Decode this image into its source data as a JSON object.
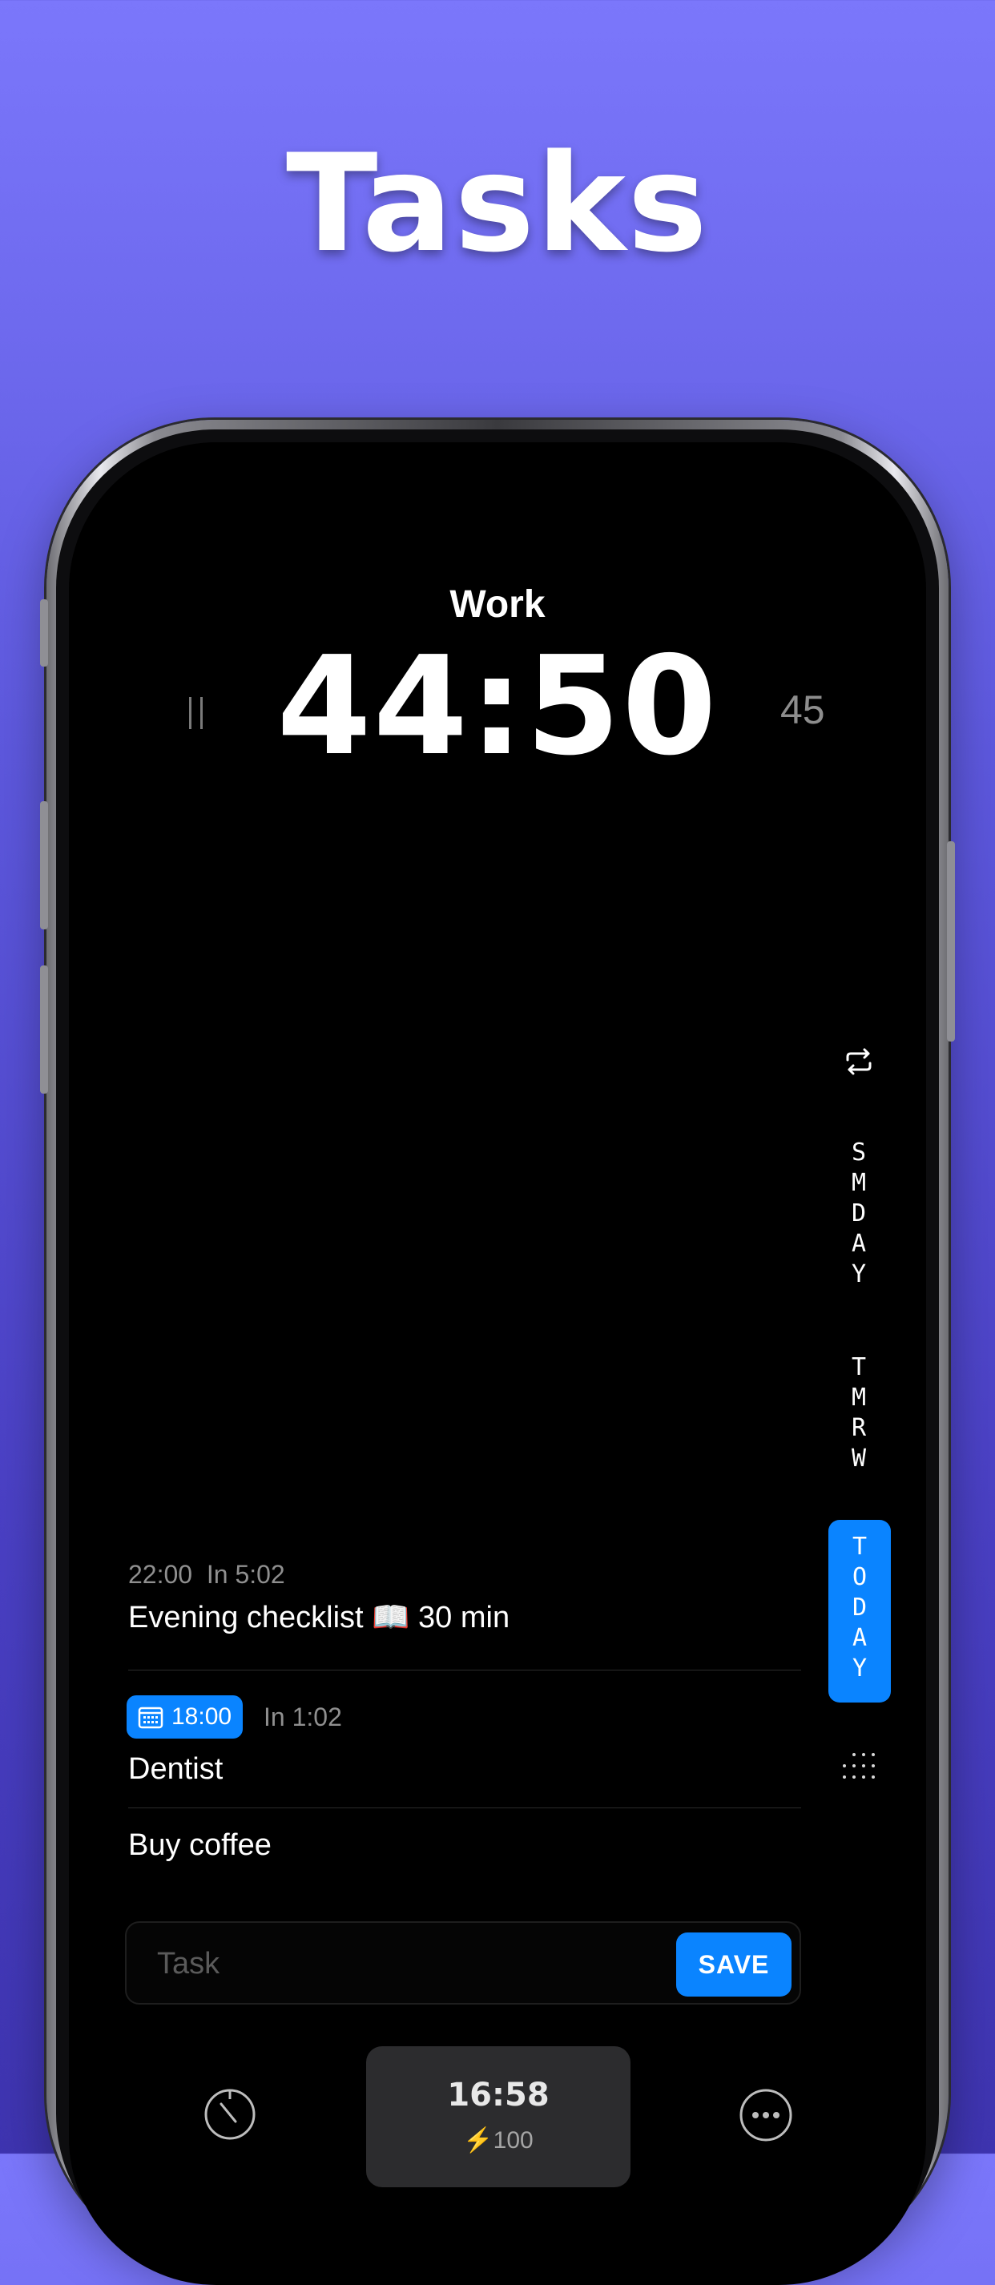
{
  "headline": "Tasks",
  "timer": {
    "mode": "Work",
    "time": "44:50",
    "duration": "45",
    "pause_icon": "pause-icon"
  },
  "day_selector": {
    "repeat_icon": "repeat-icon",
    "items": [
      {
        "label": "SMDAY",
        "letters": [
          "S",
          "M",
          "D",
          "A",
          "Y"
        ]
      },
      {
        "label": "TMRW",
        "letters": [
          "T",
          "M",
          "R",
          "W"
        ]
      },
      {
        "label": "TODAY",
        "letters": [
          "T",
          "O",
          "D",
          "A",
          "Y"
        ],
        "selected": true
      }
    ],
    "grid_icon": "dot-grid-icon"
  },
  "tasks": [
    {
      "time": "22:00",
      "relative": "In 5:02",
      "title": "Evening checklist 📖 30 min"
    },
    {
      "badge_time": "18:00",
      "relative": "In 1:02",
      "title": "Dentist",
      "badge_icon": "calendar-icon"
    },
    {
      "title": "Buy coffee"
    }
  ],
  "composer": {
    "placeholder": "Task",
    "value": "",
    "save_label": "SAVE"
  },
  "bottom_bar": {
    "left_icon": "timer-icon",
    "clock": "16:58",
    "battery": "100",
    "battery_icon": "lightning-icon",
    "right_icon": "more-icon"
  },
  "colors": {
    "accent": "#0a84ff",
    "background_top": "#7b77fb",
    "background_bottom": "#3e34b0",
    "screen": "#000000"
  }
}
